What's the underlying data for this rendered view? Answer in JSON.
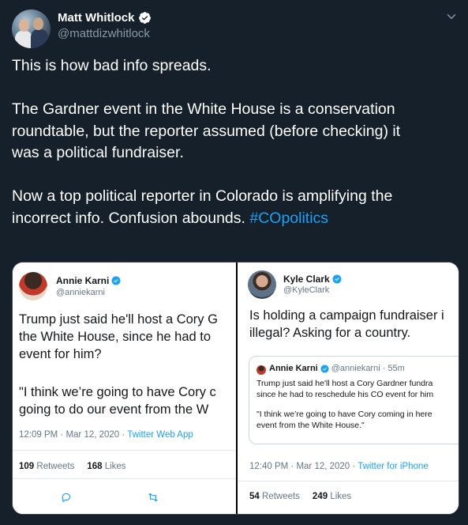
{
  "tweet": {
    "author": {
      "display_name": "Matt Whitlock",
      "handle": "@mattdizwhitlock",
      "verified_icon": "verified-badge-icon",
      "menu_icon": "chevron-down-icon"
    },
    "text": {
      "line1": "This is how bad info spreads.",
      "line2": "The Gardner event in the White House is a conservation",
      "line3": "roundtable, but the reporter assumed (before checking) it",
      "line4": "was a political fundraiser.",
      "line5": "Now a top political reporter in Colorado is amplifying the",
      "line6_prefix": "incorrect info. Confusion abounds. ",
      "hashtag": "#COpolitics"
    },
    "colors": {
      "background": "#15202b",
      "accent": "#1da1f2",
      "secondary_text": "#8899a6"
    }
  },
  "media": {
    "left": {
      "author_name": "Annie Karni",
      "author_handle": "@anniekarni",
      "text_line1": "Trump just said he'll host a Cory G",
      "text_line2": "the White House, since he had to",
      "text_line3": "event for him?",
      "text_line4": "\"I think we’re going to have Cory c",
      "text_line5": "going to do our event from the W",
      "meta_time": "12:09 PM · Mar 12, 2020 · ",
      "meta_app": "Twitter Web App",
      "retweets_count": "109",
      "retweets_label": "Retweets",
      "likes_count": "168",
      "likes_label": "Likes",
      "reply_icon": "reply-icon",
      "retweet_icon": "retweet-icon"
    },
    "right": {
      "author_name": "Kyle Clark",
      "author_handle": "@KyleClark",
      "text_line1": "Is holding a campaign fundraiser i",
      "text_line2": "illegal? Asking for a country.",
      "quote": {
        "author_name": "Annie Karni",
        "author_handle": "@anniekarni · 55m",
        "line1": "Trump just said he'll host a Cory Gardner fundra",
        "line2": "since he had to reschedule his CO event for him",
        "line3": "\"I think we’re going to have Cory coming in here",
        "line4": "event from the White House.\""
      },
      "meta_time": "12:40 PM · Mar 12, 2020 · ",
      "meta_app": "Twitter for iPhone",
      "retweets_count": "54",
      "retweets_label": "Retweets",
      "likes_count": "249",
      "likes_label": "Likes"
    }
  }
}
